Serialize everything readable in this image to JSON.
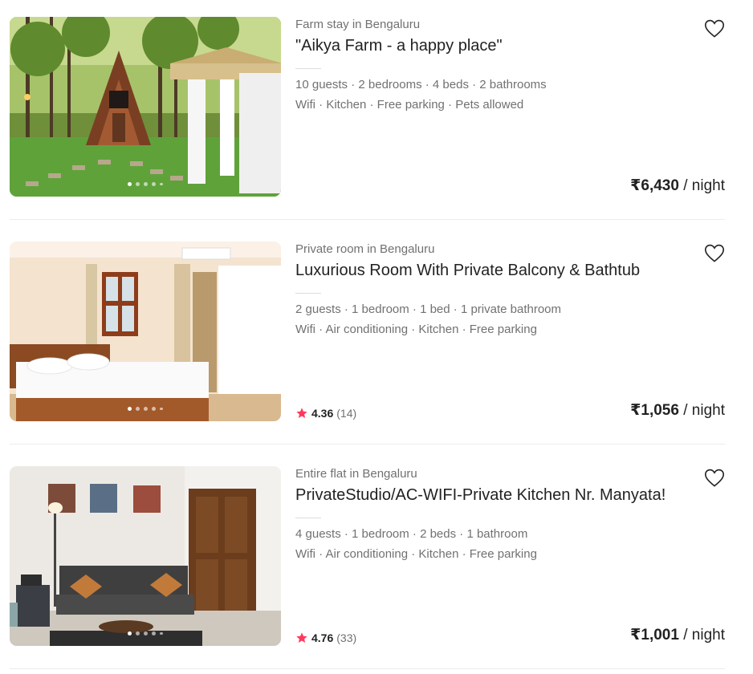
{
  "listings": [
    {
      "type": "Farm stay in Bengaluru",
      "title": "\"Aikya Farm - a happy place\"",
      "details": "10 guests · 2 bedrooms · 4 beds · 2 bathrooms",
      "amenities": "Wifi · Kitchen · Free parking · Pets allowed",
      "price": "₹6,430",
      "price_unit": " / night"
    },
    {
      "type": "Private room in Bengaluru",
      "title": "Luxurious Room With Private Balcony & Bathtub",
      "details": "2 guests · 1 bedroom · 1 bed · 1 private bathroom",
      "amenities": "Wifi · Air conditioning · Kitchen · Free parking",
      "rating": "4.36",
      "reviews": "(14)",
      "price": "₹1,056",
      "price_unit": " / night"
    },
    {
      "type": "Entire flat in Bengaluru",
      "title": "PrivateStudio/AC-WIFI-Private Kitchen Nr. Manyata!",
      "details": "4 guests · 1 bedroom · 2 beds · 1 bathroom",
      "amenities": "Wifi · Air conditioning · Kitchen · Free parking",
      "rating": "4.76",
      "reviews": "(33)",
      "price": "₹1,001",
      "price_unit": " / night"
    }
  ],
  "colors": {
    "star": "#ff385c",
    "muted_text": "#717171",
    "text": "#222222",
    "divider": "#ebebeb"
  },
  "icons": {
    "wishlist": "heart-outline-icon",
    "rating": "star-icon"
  }
}
